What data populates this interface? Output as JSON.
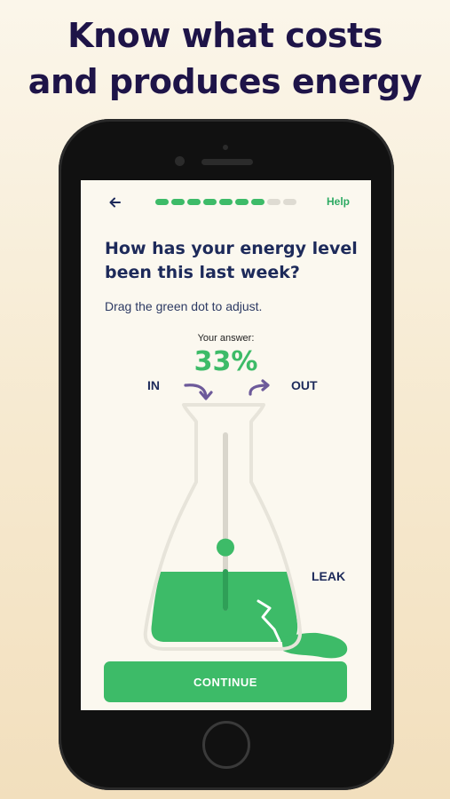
{
  "promo": {
    "headline_line1": "Know what costs",
    "headline_line2": "and produces energy"
  },
  "header": {
    "back_icon": "arrow-left-icon",
    "progress": {
      "total_steps": 9,
      "completed_steps": 7
    },
    "help_label": "Help"
  },
  "question": {
    "title": "How has your energy level been this last week?",
    "instruction": "Drag the green dot to adjust."
  },
  "answer": {
    "label": "Your answer:",
    "value": "33%",
    "level": 0.33
  },
  "flask": {
    "in_label": "IN",
    "out_label": "OUT",
    "leak_label": "LEAK"
  },
  "actions": {
    "continue_label": "CONTINUE"
  },
  "colors": {
    "brand_green": "#3dbb68",
    "navy_text": "#1d2a5a",
    "headline": "#1e1448",
    "arrow_purple": "#6d5a9a"
  }
}
